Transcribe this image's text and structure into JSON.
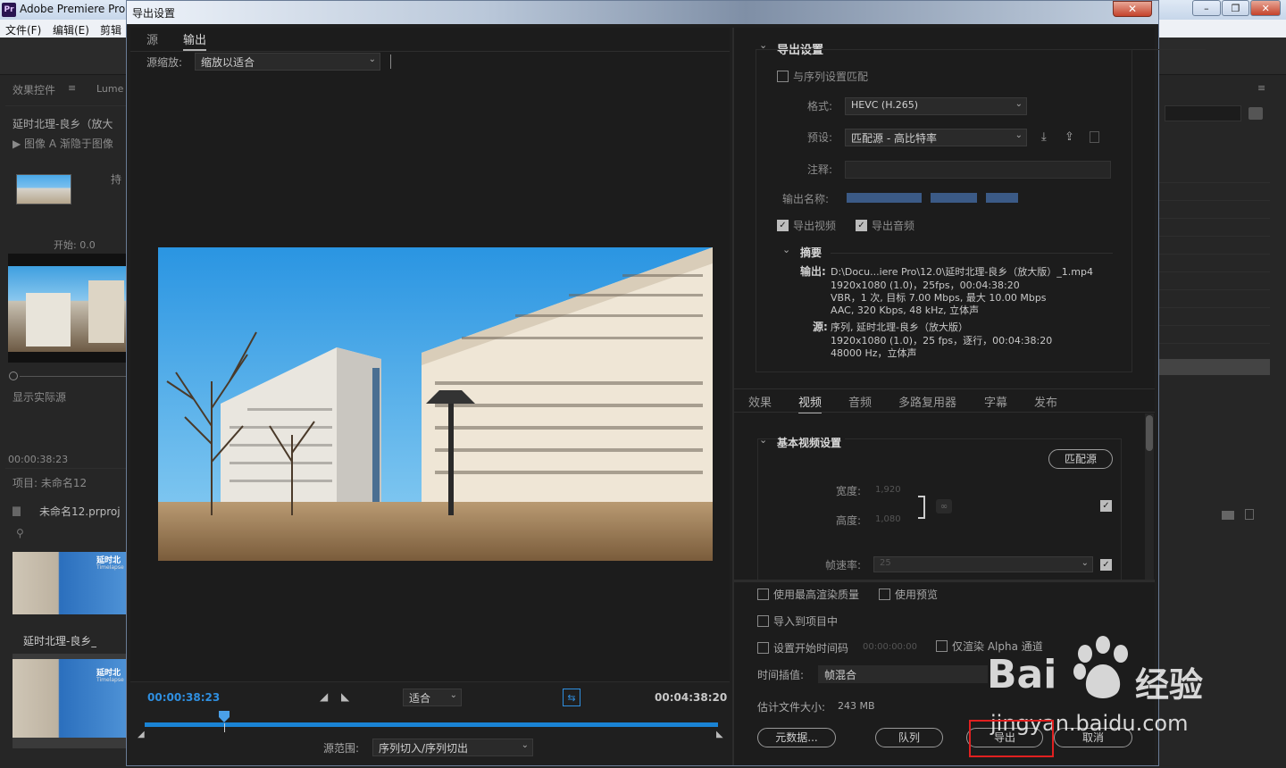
{
  "app": {
    "title": "Adobe Premiere Pro",
    "logo": "Pr",
    "menu": [
      "文件(F)",
      "编辑(E)",
      "剪辑"
    ],
    "window_controls": [
      "–",
      "❐",
      "✕"
    ]
  },
  "left_panel": {
    "tab_effect_controls": "效果控件",
    "tab_lumetri": "Lume",
    "clip_name": "延时北理-良乡（放大",
    "effect_row": "图像 A 渐隐于图像",
    "persist_label": "持",
    "start_label": "开始: 0.0",
    "show_actual_source": "显示实际源",
    "timecode": "00:00:38:23",
    "project_label": "项目: 未命名12",
    "project_file": "未命名12.prproj",
    "clip_thumb_label": "延时北理-良乡_",
    "thumb_text_1": "延时北",
    "thumb_text_2": "Timelapse"
  },
  "dialog": {
    "title": "导出设置",
    "close": "✕",
    "left": {
      "tabs": [
        {
          "label": "源",
          "active": false
        },
        {
          "label": "输出",
          "active": true
        }
      ],
      "source_scale_label": "源缩放:",
      "source_scale_value": "缩放以适合",
      "current_time": "00:00:38:23",
      "end_time": "00:04:38:20",
      "fit_value": "适合",
      "source_range_label": "源范围:",
      "source_range_value": "序列切入/序列切出",
      "playhead_fraction": 0.138
    },
    "right": {
      "export_settings_title": "导出设置",
      "match_sequence_label": "与序列设置匹配",
      "format_label": "格式:",
      "format_value": "HEVC (H.265)",
      "preset_label": "预设:",
      "preset_value": "匹配源 - 高比特率",
      "comment_label": "注释:",
      "output_name_label": "输出名称:",
      "export_video_label": "导出视频",
      "export_audio_label": "导出音频",
      "summary_title": "摘要",
      "output_label": "输出:",
      "output_lines": [
        "D:\\Docu...iere Pro\\12.0\\延时北理-良乡（放大版）_1.mp4",
        "1920x1080 (1.0)，25fps，00:04:38:20",
        "VBR，1 次, 目标 7.00 Mbps, 最大 10.00 Mbps",
        "AAC, 320 Kbps, 48 kHz, 立体声"
      ],
      "source_label": "源:",
      "source_lines": [
        "序列, 延时北理-良乡（放大版）",
        "1920x1080 (1.0)，25 fps，逐行，00:04:38:20",
        "48000 Hz，立体声"
      ],
      "sub_tabs": [
        {
          "label": "效果",
          "active": false
        },
        {
          "label": "视频",
          "active": true
        },
        {
          "label": "音频",
          "active": false
        },
        {
          "label": "多路复用器",
          "active": false
        },
        {
          "label": "字幕",
          "active": false
        },
        {
          "label": "发布",
          "active": false
        }
      ],
      "basic_video_title": "基本视频设置",
      "match_source_button": "匹配源",
      "width_label": "宽度:",
      "width_value": "1,920",
      "height_label": "高度:",
      "height_value": "1,080",
      "framerate_label": "帧速率:",
      "framerate_value": "25",
      "use_max_quality": "使用最高渲染质量",
      "use_previews": "使用预览",
      "import_into_project": "导入到项目中",
      "set_start_timecode": "设置开始时间码",
      "start_timecode_value": "00:00:00:00",
      "render_alpha_only": "仅渲染 Alpha 通道",
      "time_interpolation_label": "时间插值:",
      "time_interpolation_value": "帧混合",
      "estimated_size_label": "估计文件大小:",
      "estimated_size_value": "243 MB",
      "metadata_button": "元数据...",
      "queue_button": "队列",
      "export_button": "导出",
      "cancel_button": "取消"
    }
  },
  "watermark": {
    "brand": "Bai",
    "brand_suffix": "经验",
    "url": "jingyan.baidu.com"
  },
  "colors": {
    "accent_blue": "#1a83d4",
    "highlight_red": "#e02020",
    "timecode_blue": "#2f8fe0"
  }
}
